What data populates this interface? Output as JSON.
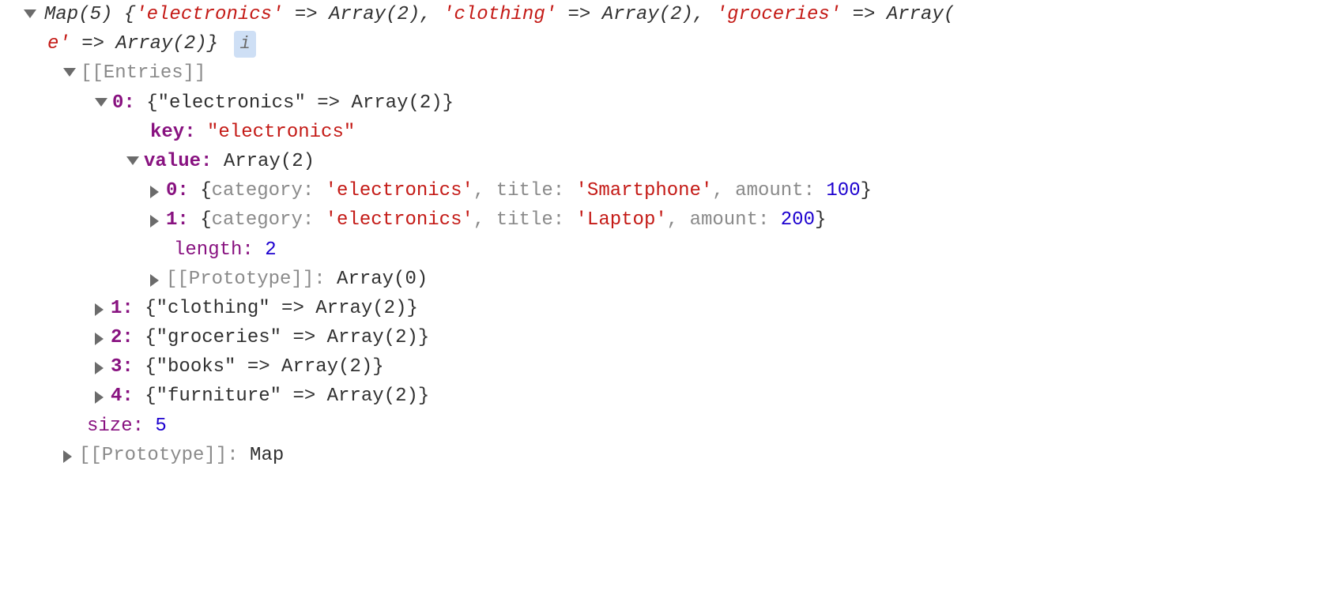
{
  "summary": {
    "prefix": "Map(5) {",
    "k1": "'electronics'",
    "arrow": " => ",
    "arr2": "Array(2)",
    "comma": ", ",
    "k2": "'clothing'",
    "k3": "'groceries'",
    "tail": "Array(",
    "line2_key": "e'",
    "line2_rest": " => Array(2)}",
    "info": "i"
  },
  "entries_label": "[[Entries]]",
  "entry0": {
    "idx": "0:",
    "head": " {\"electronics\" => Array(2)}",
    "key_label": "key:",
    "key_val": " \"electronics\"",
    "value_label": "value:",
    "value_type": " Array(2)"
  },
  "item0": {
    "idx": "0:",
    "open": " {",
    "p_cat": "category: ",
    "v_cat": "'electronics'",
    "sep": ", ",
    "p_title": "title: ",
    "v_title": "'Smartphone'",
    "p_amount": "amount: ",
    "v_amount": "100",
    "close": "}"
  },
  "item1": {
    "idx": "1:",
    "open": " {",
    "p_cat": "category: ",
    "v_cat": "'electronics'",
    "sep": ", ",
    "p_title": "title: ",
    "v_title": "'Laptop'",
    "p_amount": "amount: ",
    "v_amount": "200",
    "close": "}"
  },
  "length": {
    "label": "length:",
    "val": " 2"
  },
  "proto_arr": {
    "label": "[[Prototype]]:",
    "val": " Array(0)"
  },
  "entry1": {
    "idx": "1:",
    "head": " {\"clothing\" => Array(2)}"
  },
  "entry2": {
    "idx": "2:",
    "head": " {\"groceries\" => Array(2)}"
  },
  "entry3": {
    "idx": "3:",
    "head": " {\"books\" => Array(2)}"
  },
  "entry4": {
    "idx": "4:",
    "head": " {\"furniture\" => Array(2)}"
  },
  "size": {
    "label": "size:",
    "val": " 5"
  },
  "proto_map": {
    "label": "[[Prototype]]:",
    "val": " Map"
  }
}
